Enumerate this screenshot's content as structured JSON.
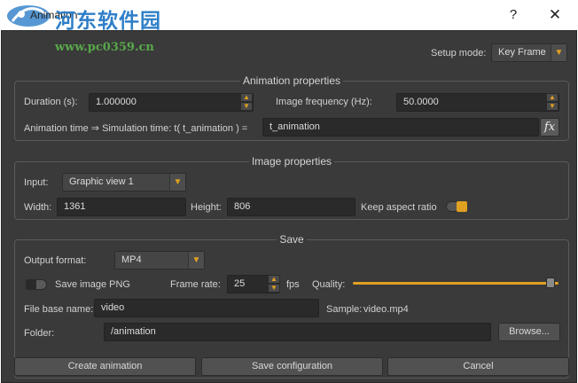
{
  "window": {
    "title": "Animation",
    "help_label": "?",
    "close_label": "✕",
    "watermark_name": "河东软件园",
    "watermark_url": "www.pc0359.cn"
  },
  "setup": {
    "label": "Setup mode:",
    "value": "Key Frame"
  },
  "animation_properties": {
    "title": "Animation properties",
    "duration_label": "Duration (s):",
    "duration_value": "1.000000",
    "frequency_label": "Image frequency (Hz):",
    "frequency_value": "50.0000",
    "time_label": "Animation time ⇒ Simulation time:  t( t_animation ) =",
    "time_value": "t_animation",
    "fx_label": "fx"
  },
  "image_properties": {
    "title": "Image properties",
    "input_label": "Input:",
    "input_value": "Graphic view 1",
    "width_label": "Width:",
    "width_value": "1361",
    "height_label": "Height:",
    "height_value": "806",
    "aspect_label": "Keep aspect ratio",
    "aspect_on": true
  },
  "save": {
    "title": "Save",
    "format_label": "Output format:",
    "format_value": "MP4",
    "png_label": "Save image PNG",
    "png_on": false,
    "framerate_label": "Frame rate:",
    "framerate_value": "25",
    "fps_label": "fps",
    "quality_label": "Quality:",
    "quality_level": 0.96,
    "basename_label": "File base name:",
    "basename_value": "video",
    "sample_label": "Sample:",
    "sample_value": "video.mp4",
    "folder_label": "Folder:",
    "folder_value": "/animation",
    "browse_label": "Browse..."
  },
  "buttons": {
    "create": "Create animation",
    "save_config": "Save configuration",
    "cancel": "Cancel"
  },
  "colors": {
    "accent": "#e0a020",
    "dialog_bg": "#3a3a3a",
    "field_bg": "#2a2a2a"
  }
}
